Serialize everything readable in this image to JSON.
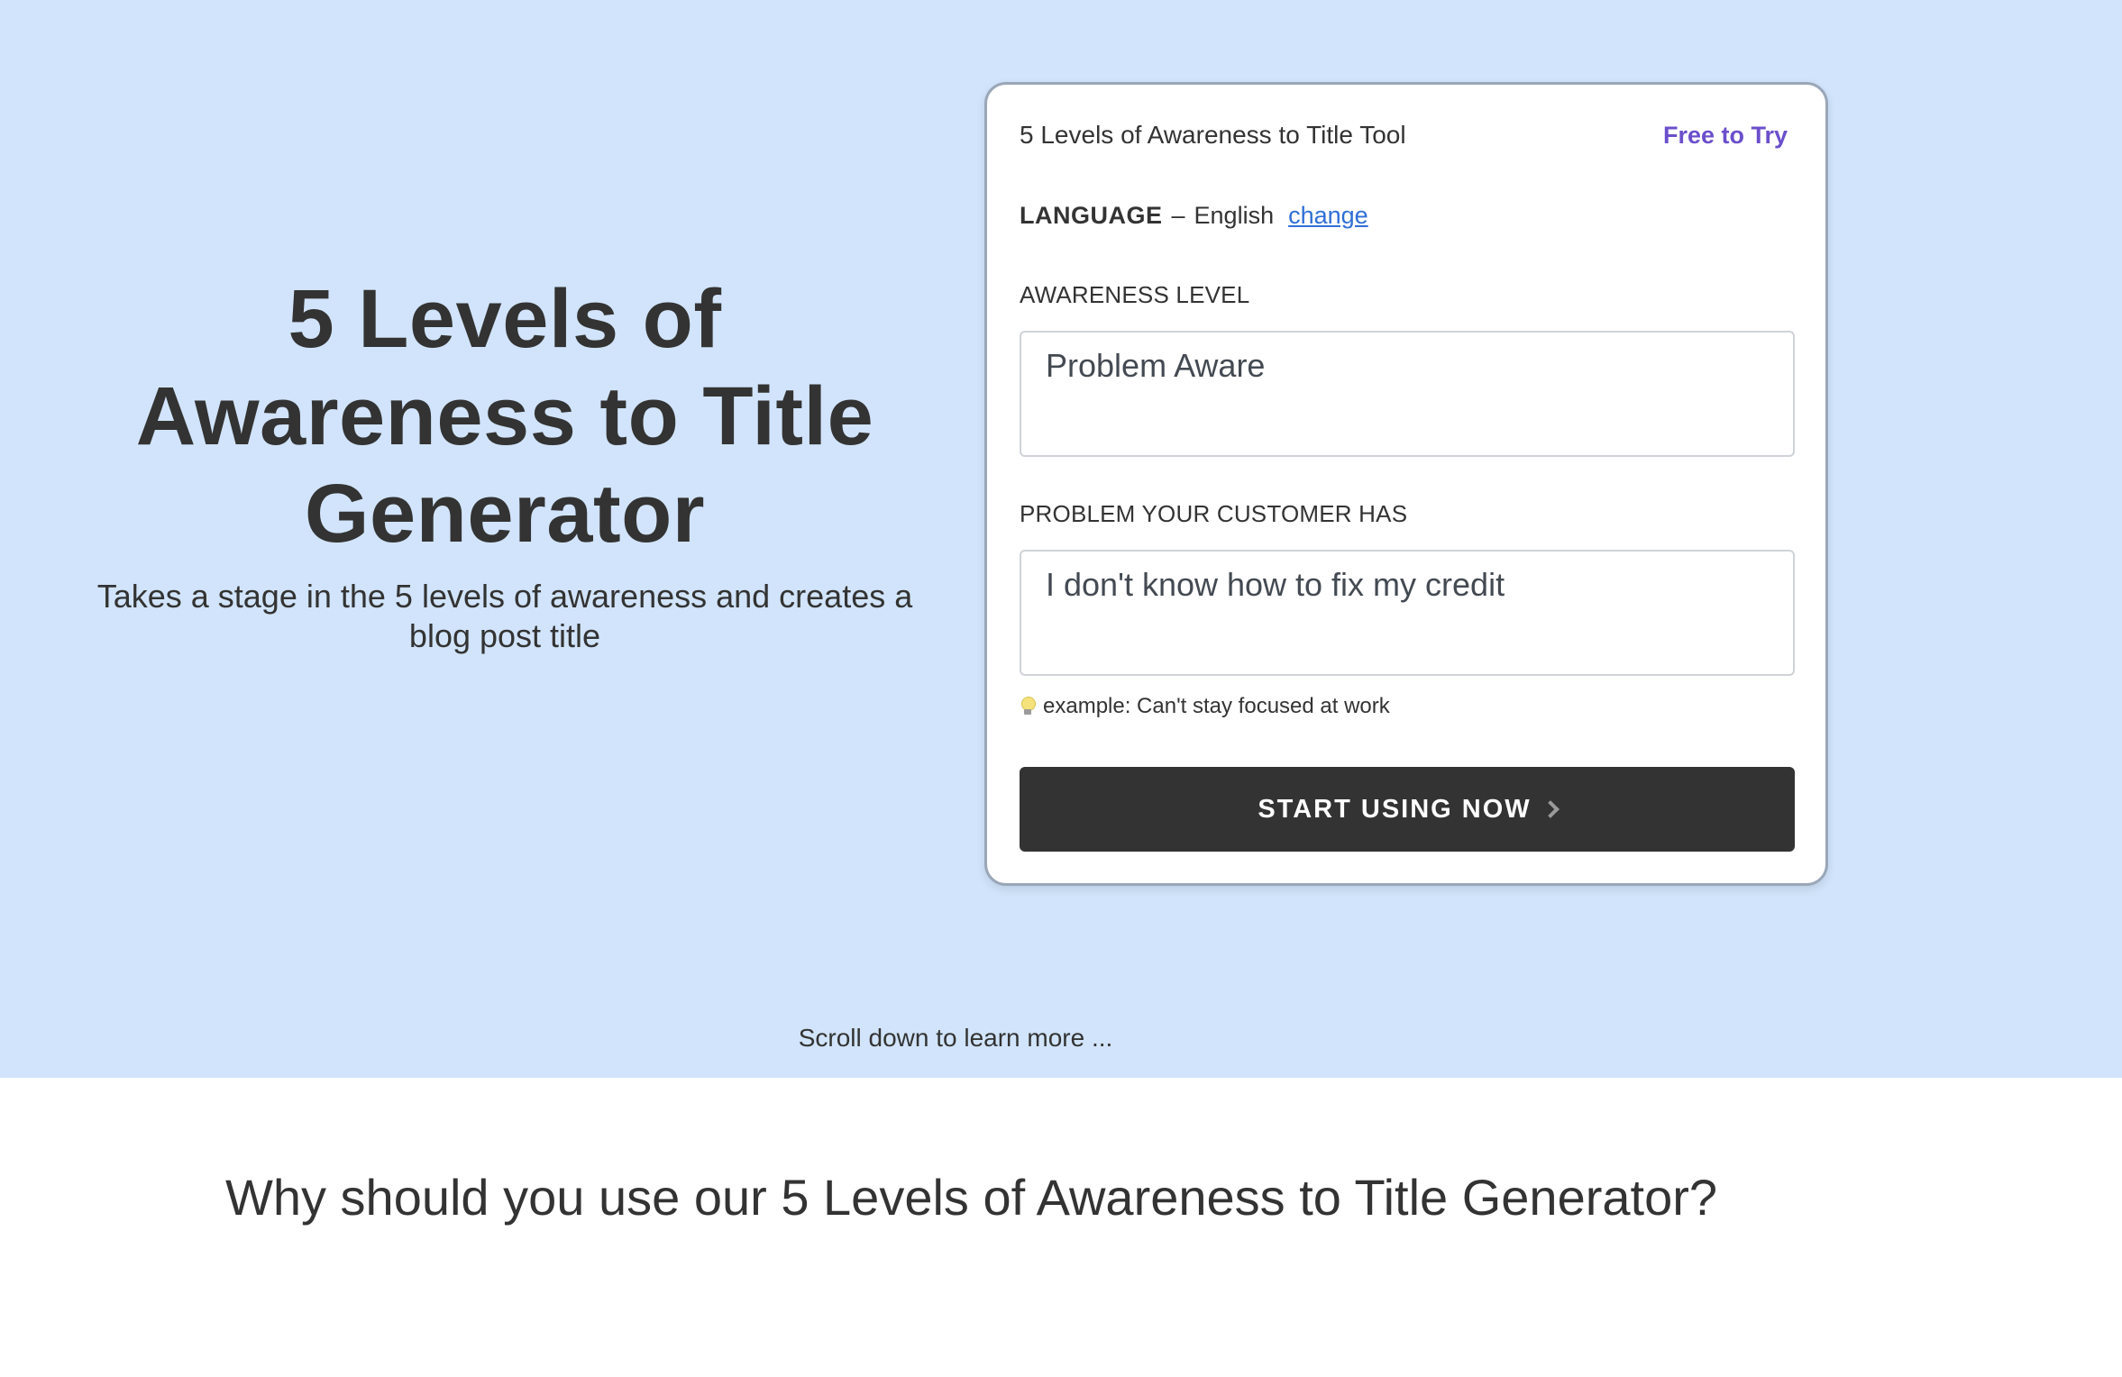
{
  "hero": {
    "title": "5 Levels of Awareness to Title Generator",
    "subtitle": "Takes a stage in the 5 levels of awareness and creates a blog post title",
    "scroll_hint": "Scroll down to learn more ..."
  },
  "tool_card": {
    "title": "5 Levels of Awareness to Title Tool",
    "badge": "Free to Try",
    "language": {
      "label": "LANGUAGE",
      "separator": "–",
      "value": "English",
      "change_link": "change"
    },
    "awareness_field": {
      "label": "AWARENESS LEVEL",
      "value": "Problem Aware"
    },
    "problem_field": {
      "label": "PROBLEM YOUR CUSTOMER HAS",
      "value": "I don't know how to fix my credit"
    },
    "example_hint": "example: Can't stay focused at work",
    "start_button": "START USING NOW"
  },
  "section": {
    "heading": "Why should you use our 5 Levels of Awareness to Title Generator?"
  },
  "colors": {
    "hero_background": "#d1e4fb",
    "button_background": "#333333",
    "badge_color": "#6b4fcc",
    "link_color": "#2f6fd6"
  }
}
